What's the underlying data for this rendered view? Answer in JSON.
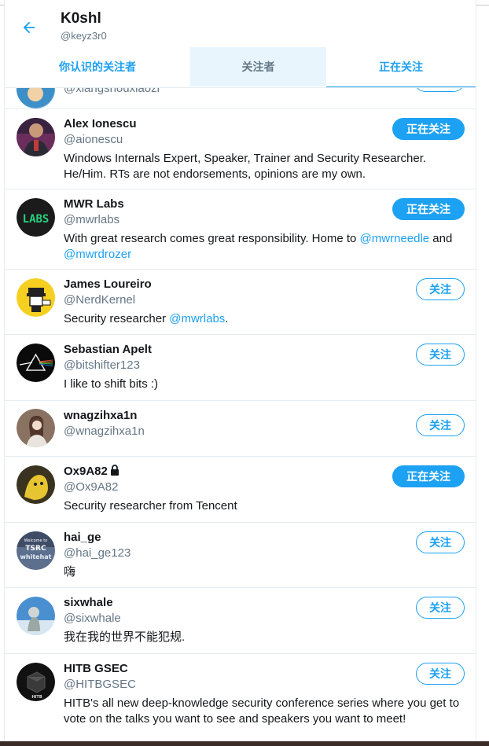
{
  "header": {
    "name": "K0shl",
    "handle": "@keyz3r0"
  },
  "tabs": [
    {
      "label": "你认识的关注者"
    },
    {
      "label": "关注者"
    },
    {
      "label": "正在关注"
    }
  ],
  "partial_row": {
    "handle": "@xiangshouxiaozi"
  },
  "users": [
    {
      "name": "Alex Ionescu",
      "handle": "@aionescu",
      "button": "正在关注",
      "bio": [
        "Windows Internals Expert, Speaker, Trainer and Security Researcher. He/Him. RTs are not endorsements, opinions are my own."
      ]
    },
    {
      "name": "MWR Labs",
      "handle": "@mwrlabs",
      "button": "正在关注",
      "bio": [
        "With great research comes great responsibility. Home to ",
        "@mwrneedle",
        " and ",
        "@mwrdrozer"
      ]
    },
    {
      "name": "James Loureiro",
      "handle": "@NerdKernel",
      "button": "关注",
      "bio": [
        "Security researcher ",
        "@mwrlabs",
        "."
      ]
    },
    {
      "name": "Sebastian Apelt",
      "handle": "@bitshifter123",
      "button": "关注",
      "bio": [
        "I like to shift bits :)"
      ]
    },
    {
      "name": "wnagzihxa1n",
      "handle": "@wnagzihxa1n",
      "button": "关注",
      "bio": []
    },
    {
      "name": "Ox9A82",
      "handle": "@Ox9A82",
      "button": "正在关注",
      "bio": [
        "Security researcher from Tencent"
      ]
    },
    {
      "name": "hai_ge",
      "handle": "@hai_ge123",
      "button": "关注",
      "bio": [
        "嗨"
      ]
    },
    {
      "name": "sixwhale",
      "handle": "@sixwhale",
      "button": "关注",
      "bio": [
        "我在我的世界不能犯规."
      ]
    },
    {
      "name": "HITB GSEC",
      "handle": "@HITBGSEC",
      "button": "关注",
      "bio": [
        "HITB's all new deep-knowledge security conference series where you get to vote on the talks you want to see and speakers you want to meet!"
      ]
    }
  ],
  "avatar_text": {
    "mwr": "LABS",
    "hai_ge_1": "Welcome to",
    "hai_ge_2": "TSRC",
    "hai_ge_3": "whitehat",
    "hitb": "HITB"
  },
  "colors": {
    "accent": "#1da1f2",
    "text": "#14171a",
    "secondary": "#657786",
    "divider": "#e6ecf0"
  }
}
